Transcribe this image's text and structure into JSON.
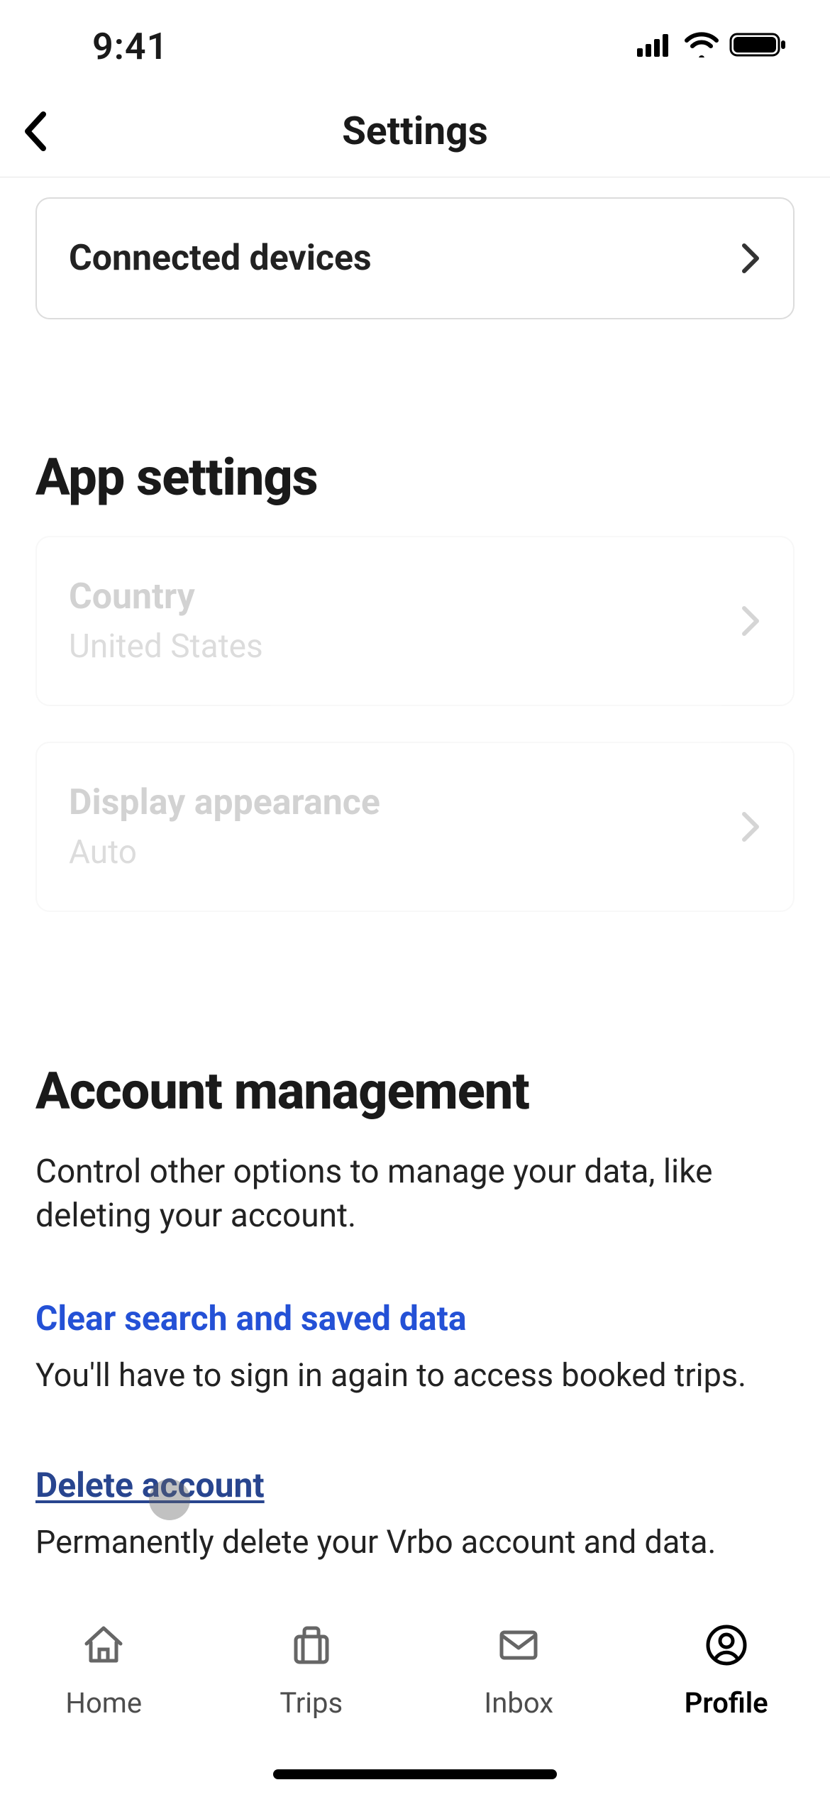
{
  "status": {
    "time": "9:41"
  },
  "header": {
    "title": "Settings"
  },
  "rows": {
    "connected": {
      "label": "Connected devices"
    },
    "country": {
      "label": "Country",
      "value": "United States"
    },
    "display": {
      "label": "Display appearance",
      "value": "Auto"
    }
  },
  "sections": {
    "app": {
      "title": "App settings"
    },
    "account": {
      "title": "Account management",
      "subtitle": "Control other options to manage your data, like deleting your account."
    }
  },
  "links": {
    "clear": {
      "label": "Clear search and saved data",
      "desc": "You'll have to sign in again to access booked trips."
    },
    "delete": {
      "label": "Delete account",
      "desc": "Permanently delete your Vrbo account and data."
    }
  },
  "tabs": {
    "home": "Home",
    "trips": "Trips",
    "inbox": "Inbox",
    "profile": "Profile"
  }
}
